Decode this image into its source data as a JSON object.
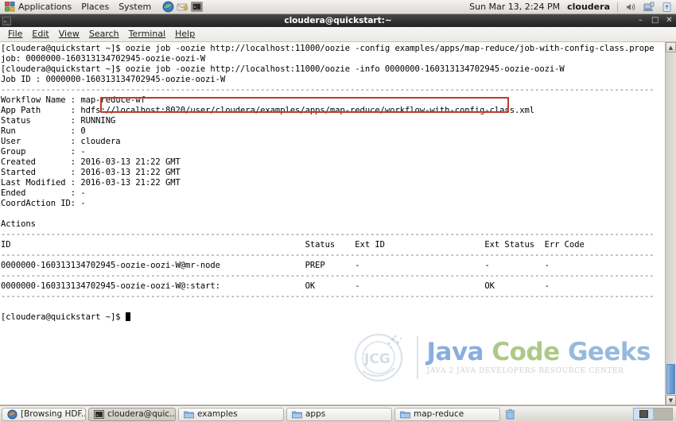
{
  "top_panel": {
    "menus": [
      "Applications",
      "Places",
      "System"
    ],
    "launchers": [
      {
        "name": "firefox-icon",
        "label": "Firefox Web Browser"
      },
      {
        "name": "email-icon",
        "label": "Evolution Mail"
      },
      {
        "name": "terminal-icon",
        "label": "Terminal"
      }
    ],
    "clock": "Sun Mar 13,  2:24 PM",
    "user": "cloudera",
    "tray": [
      {
        "name": "volume-icon"
      },
      {
        "name": "network-icon"
      },
      {
        "name": "update-manager-icon"
      }
    ]
  },
  "window": {
    "title": "cloudera@quickstart:~",
    "icon_name": "terminal-icon",
    "buttons": {
      "minimize": "–",
      "maximize": "□",
      "close": "✕"
    },
    "menubar": [
      {
        "label": "File",
        "accel": "F"
      },
      {
        "label": "Edit",
        "accel": "E"
      },
      {
        "label": "View",
        "accel": "V"
      },
      {
        "label": "Search",
        "accel": "S"
      },
      {
        "label": "Terminal",
        "accel": "T"
      },
      {
        "label": "Help",
        "accel": "H"
      }
    ]
  },
  "terminal": {
    "lines": [
      "[cloudera@quickstart ~]$ oozie job -oozie http://localhost:11000/oozie -config examples/apps/map-reduce/job-with-config-class.properties -run",
      "job: 0000000-160313134702945-oozie-oozi-W",
      "[cloudera@quickstart ~]$ oozie job -oozie http://localhost:11000/oozie -info 0000000-160313134702945-oozie-oozi-W",
      "Job ID : 0000000-160313134702945-oozie-oozi-W",
      "------------------------------------------------------------------------------------------------------------------------------------",
      "Workflow Name : map-reduce-wf",
      "App Path      : hdfs://localhost:8020/user/cloudera/examples/apps/map-reduce/workflow-with-config-class.xml",
      "Status        : RUNNING",
      "Run           : 0",
      "User          : cloudera",
      "Group         : -",
      "Created       : 2016-03-13 21:22 GMT",
      "Started       : 2016-03-13 21:22 GMT",
      "Last Modified : 2016-03-13 21:22 GMT",
      "Ended         : -",
      "CoordAction ID: -",
      "",
      "Actions",
      "------------------------------------------------------------------------------------------------------------------------------------",
      "ID                                                           Status    Ext ID                    Ext Status  Err Code",
      "------------------------------------------------------------------------------------------------------------------------------------",
      "0000000-160313134702945-oozie-oozi-W@mr-node                 PREP      -                         -           -",
      "------------------------------------------------------------------------------------------------------------------------------------",
      "0000000-160313134702945-oozie-oozi-W@:start:                 OK        -                         OK          -",
      "------------------------------------------------------------------------------------------------------------------------------------",
      "",
      "[cloudera@quickstart ~]$ "
    ],
    "prompt": "[cloudera@quickstart ~]$ ",
    "annotation": {
      "name": "red-highlight-box",
      "color": "#c0392b",
      "target_text": "oozie job -oozie http://localhost:11000/oozie -info 0000000-160313134702945-oozie-oozi-W"
    },
    "scrollbar": {
      "up_arrow": "▲",
      "down_arrow": "▼"
    }
  },
  "watermark": {
    "logo_text": "JCG",
    "title_words": [
      "Java",
      "Code",
      "Geeks"
    ],
    "subtitle": "JAVA 2 JAVA DEVELOPERS RESOURCE CENTER",
    "colors": {
      "word1": "#5b8fd0",
      "word2": "#8fb45c",
      "word3": "#6fa0cf",
      "subtitle": "#b8c4ae"
    }
  },
  "taskbar": {
    "items": [
      {
        "label": "[Browsing HDF...",
        "icon": "firefox-icon",
        "active": false
      },
      {
        "label": "cloudera@quic...",
        "icon": "terminal-icon",
        "active": true
      },
      {
        "label": "examples",
        "icon": "folder-icon",
        "active": false
      },
      {
        "label": "apps",
        "icon": "folder-icon",
        "active": false
      },
      {
        "label": "map-reduce",
        "icon": "folder-icon",
        "active": false
      }
    ],
    "trash_icon": "trash-icon",
    "workspaces": [
      {
        "name": "workspace-1",
        "selected": true
      },
      {
        "name": "workspace-2",
        "selected": false
      }
    ]
  }
}
